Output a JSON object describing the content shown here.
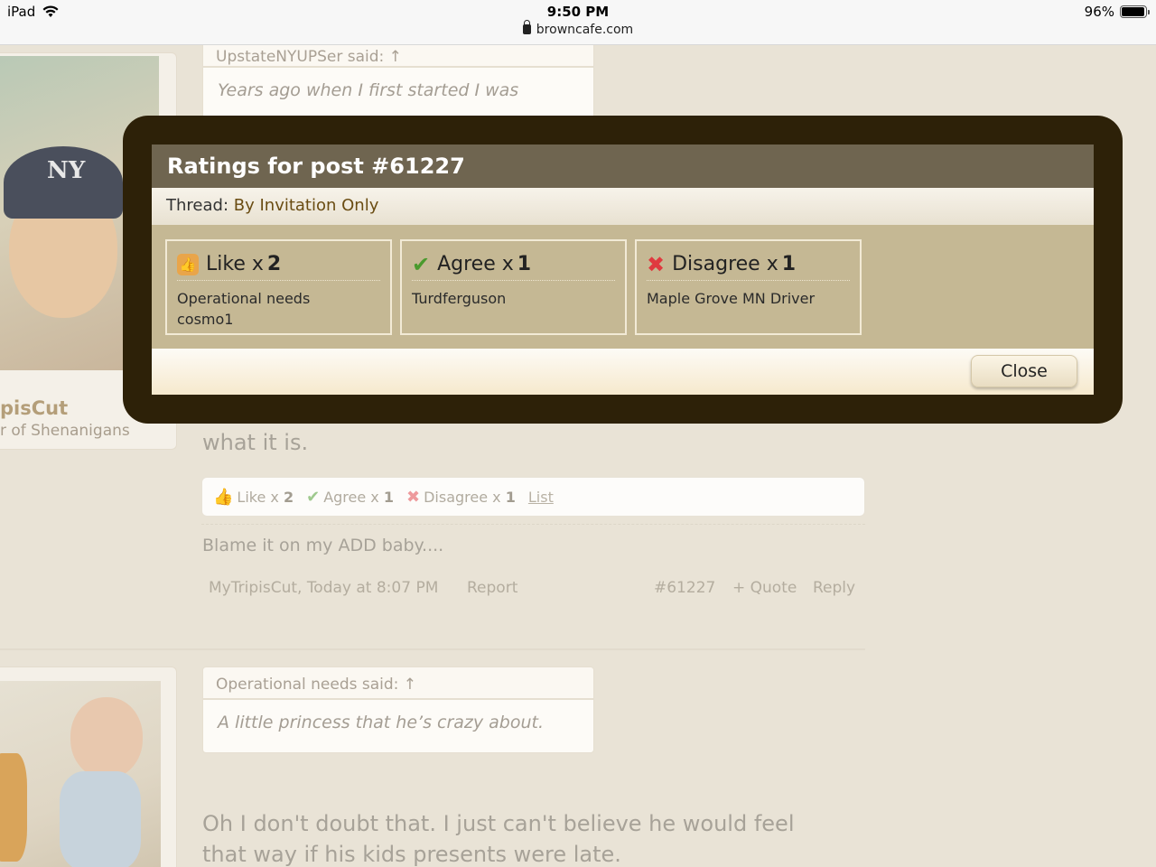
{
  "status_bar": {
    "device": "iPad",
    "time": "9:50 PM",
    "url": "browncafe.com",
    "battery": "96%",
    "battery_level": 0.96
  },
  "background": {
    "quote1": {
      "author": "UpstateNYUPSer said: ↑",
      "text": "Years ago when I first started I was"
    },
    "user1": {
      "name": "pisCut",
      "title": "r of Shenanigans",
      "cap_logo": "NY"
    },
    "post_text_tail": "what it is.",
    "ratings_bar": {
      "like_label": "Like x",
      "like_count": "2",
      "agree_label": "Agree x",
      "agree_count": "1",
      "disagree_label": "Disagree x",
      "disagree_count": "1",
      "list_link": "List"
    },
    "signature": "Blame it on my ADD baby....",
    "post_meta": {
      "author_time": "MyTripisCut, Today at 8:07 PM",
      "report": "Report",
      "post_number": "#61227",
      "quote": "+ Quote",
      "reply": "Reply"
    },
    "quote2": {
      "author": "Operational needs said: ↑",
      "text": "A little princess that he’s crazy about."
    },
    "post2_line1": "Oh I don't doubt that. I just can't believe he would feel",
    "post2_line2": "that way if his kids presents were late."
  },
  "modal": {
    "title": "Ratings for post #61227",
    "thread_label": "Thread:",
    "thread_link": "By Invitation Only",
    "ratings": [
      {
        "icon": "thumbs-up-icon",
        "label": "Like x",
        "count": "2",
        "users": [
          "Operational needs",
          "cosmo1"
        ]
      },
      {
        "icon": "check-icon",
        "label": "Agree x",
        "count": "1",
        "users": [
          "Turdferguson"
        ]
      },
      {
        "icon": "x-icon",
        "label": "Disagree x",
        "count": "1",
        "users": [
          "Maple Grove MN Driver"
        ]
      }
    ],
    "close_label": "Close"
  }
}
